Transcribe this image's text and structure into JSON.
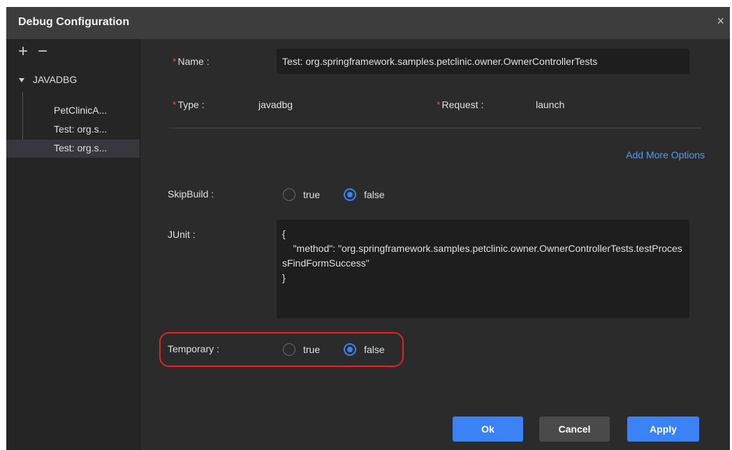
{
  "dialog": {
    "title": "Debug Configuration",
    "close_glyph": "×"
  },
  "sidebar": {
    "add_glyph": "+",
    "remove_glyph": "−",
    "tree": {
      "root_label": "JAVADBG",
      "items": [
        {
          "label": "PetClinicA...",
          "selected": false
        },
        {
          "label": "Test: org.s...",
          "selected": false
        },
        {
          "label": "Test: org.s...",
          "selected": true
        }
      ]
    }
  },
  "form": {
    "required_mark": "*",
    "name_label": "Name :",
    "name_value": "Test: org.springframework.samples.petclinic.owner.OwnerControllerTests",
    "type_label": "Type :",
    "type_value": "javadbg",
    "request_label": "Request :",
    "request_value": "launch",
    "add_more_options": "Add More Options",
    "skipbuild_label": "SkipBuild :",
    "skipbuild_options": [
      "true",
      "false"
    ],
    "skipbuild_selected": "false",
    "junit_label": "JUnit :",
    "junit_value": "{\n    \"method\": \"org.springframework.samples.petclinic.owner.OwnerControllerTests.testProcessFindFormSuccess\"\n}",
    "temporary_label": "Temporary :",
    "temporary_options": [
      "true",
      "false"
    ],
    "temporary_selected": "false"
  },
  "buttons": {
    "ok": "Ok",
    "cancel": "Cancel",
    "apply": "Apply"
  },
  "colors": {
    "accent": "#3b82f6",
    "highlight": "#e0232b",
    "link": "#4a9eff",
    "background": "#2b2b2b"
  }
}
